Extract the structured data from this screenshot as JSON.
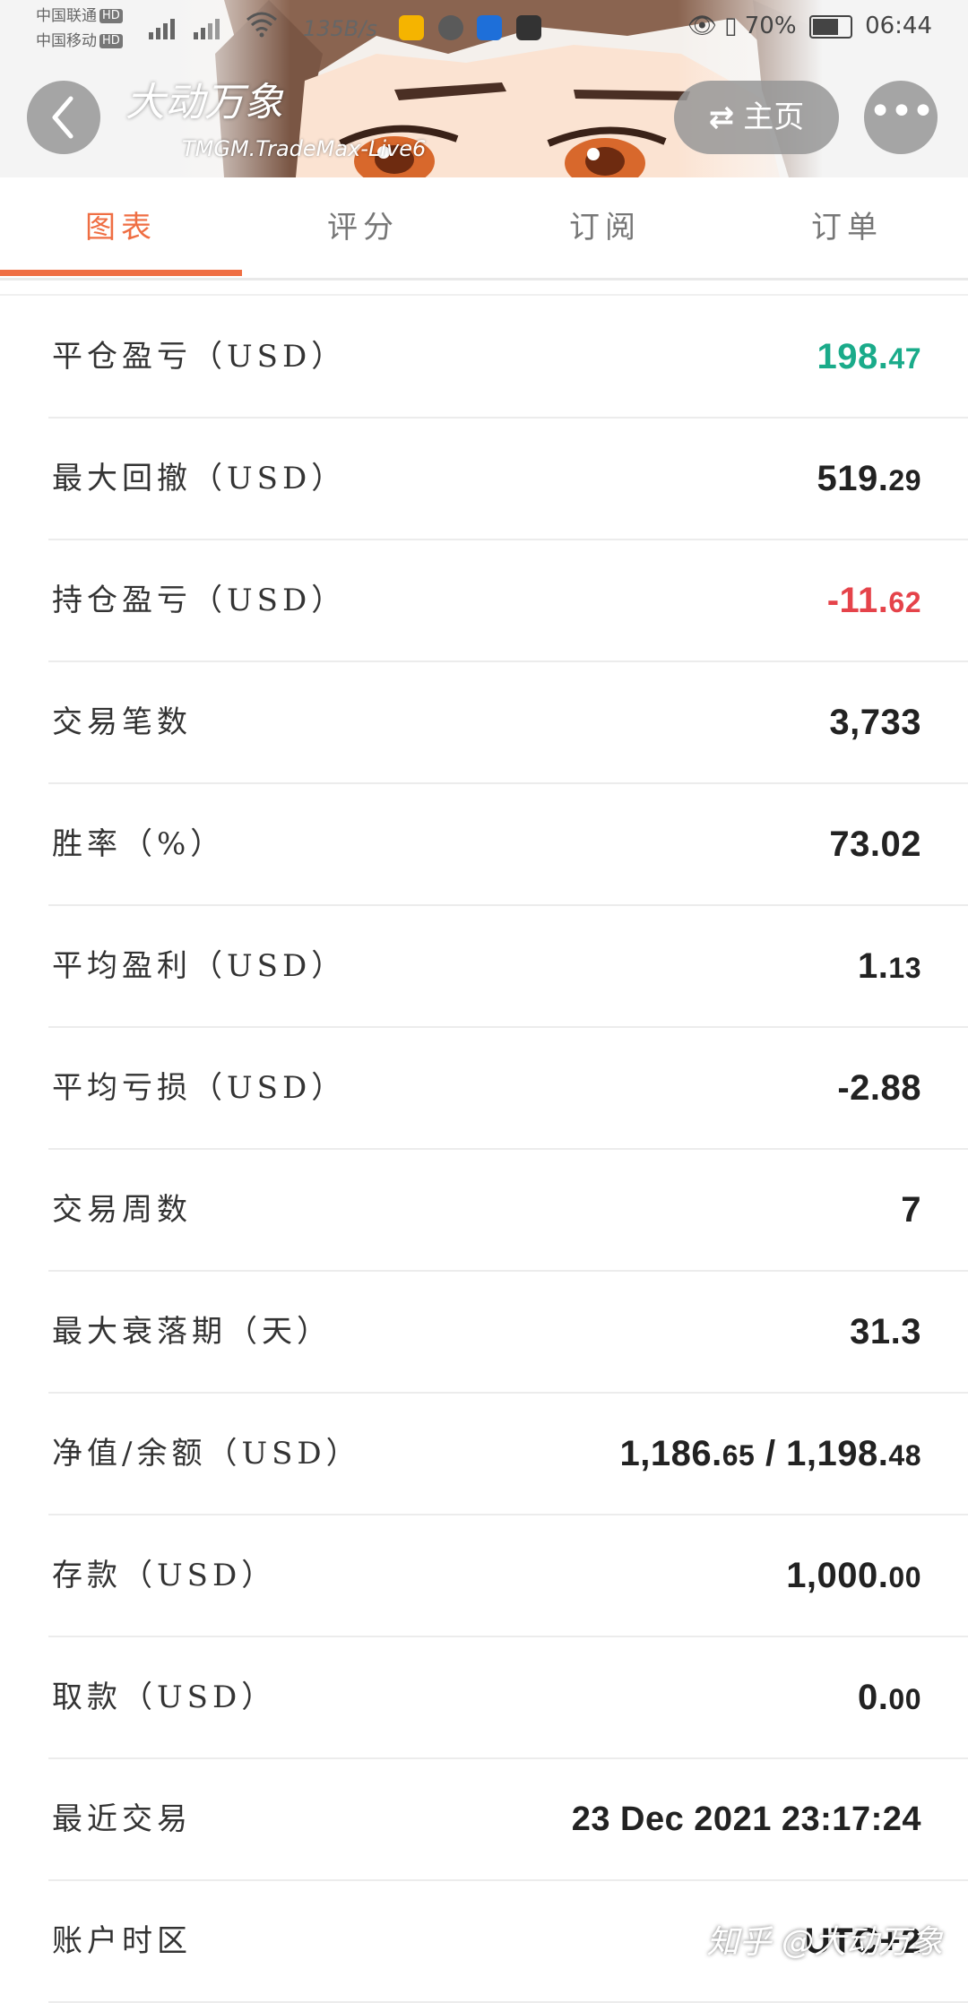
{
  "status_bar": {
    "carrier1": "中国联通",
    "carrier2": "中国移动",
    "hd": "HD",
    "net_speed": "135B/s",
    "battery": "70%",
    "time": "06:44"
  },
  "header": {
    "account_name": "大动万象",
    "server": "TMGM.TradeMax-Live6",
    "home_label": "主页",
    "back_icon": "back-chevron-icon",
    "more_icon": "more-dots-icon"
  },
  "tabs": [
    {
      "label": "图表",
      "active": true
    },
    {
      "label": "评分",
      "active": false
    },
    {
      "label": "订阅",
      "active": false
    },
    {
      "label": "订单",
      "active": false
    }
  ],
  "stats": [
    {
      "label": "平仓盈亏（USD）",
      "main": "198.",
      "small": "47",
      "color": "green"
    },
    {
      "label": "最大回撤（USD）",
      "main": "519.",
      "small": "29",
      "color": "normal"
    },
    {
      "label": "持仓盈亏（USD）",
      "main": "-11.",
      "small": "62",
      "color": "red"
    },
    {
      "label": "交易笔数",
      "main": "3,733",
      "small": "",
      "color": "normal"
    },
    {
      "label": "胜率（%）",
      "main": "73.02",
      "small": "",
      "color": "normal"
    },
    {
      "label": "平均盈利（USD）",
      "main": "1.",
      "small": "13",
      "color": "normal"
    },
    {
      "label": "平均亏损（USD）",
      "main": "-2.88",
      "small": "",
      "color": "normal"
    },
    {
      "label": "交易周数",
      "main": "7",
      "small": "",
      "color": "normal"
    },
    {
      "label": "最大衰落期（天）",
      "main": "31.3",
      "small": "",
      "color": "normal"
    },
    {
      "label": "净值/余额（USD）",
      "main": "1,186.",
      "small": "65",
      "main2": " / 1,198.",
      "small2": "48",
      "color": "normal"
    },
    {
      "label": "存款（USD）",
      "main": "1,000.",
      "small": "00",
      "color": "normal"
    },
    {
      "label": "取款（USD）",
      "main": "0.",
      "small": "00",
      "color": "normal"
    },
    {
      "label": "最近交易",
      "main": "23 Dec 2021 23:17:24",
      "small": "",
      "color": "normal"
    },
    {
      "label": "账户时区",
      "main": "UTC+2",
      "small": "",
      "color": "normal"
    }
  ],
  "colors": {
    "accent": "#ef6e43",
    "positive": "#1aab8a",
    "negative": "#e5434a"
  },
  "watermark": "知乎 @大动万象"
}
